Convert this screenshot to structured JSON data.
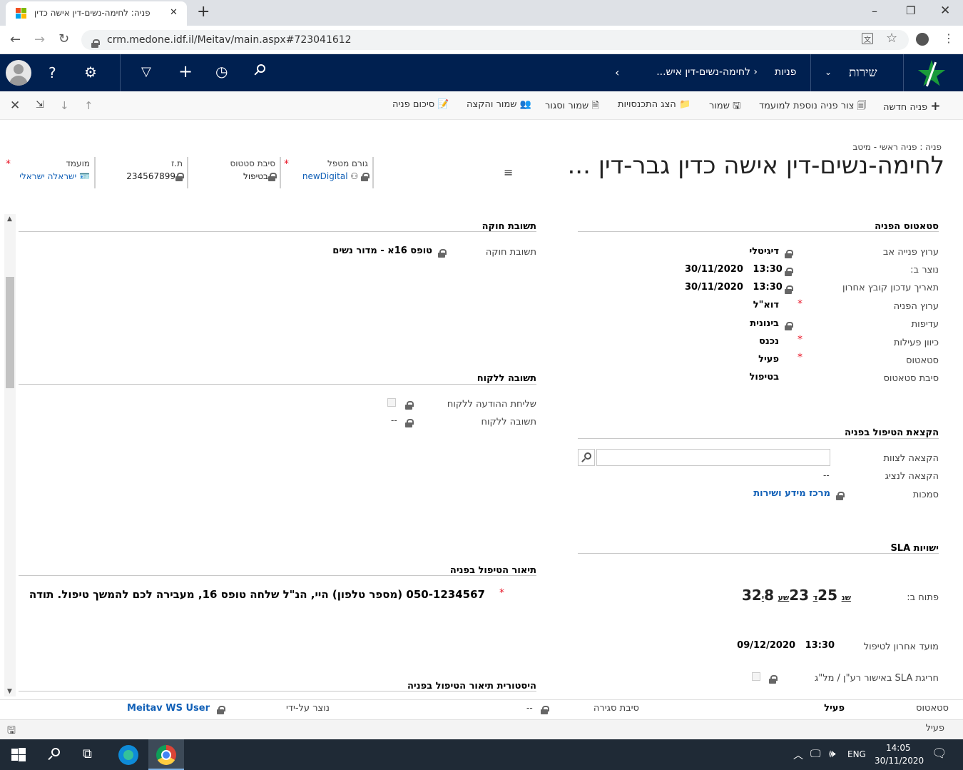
{
  "browser": {
    "tab_title": "פניה: לחימה-נשים-דין אישה כדין",
    "tab_close": "✕",
    "new_tab": "+",
    "url": "crm.medone.idf.il/Meitav/main.aspx#723041612",
    "win_min": "–",
    "win_max": "❐",
    "win_close": "✕"
  },
  "nav": {
    "app_name": "שירות",
    "area": "פניות",
    "record": "לחימה-נשים-דין איש..."
  },
  "toolbar": {
    "new_case": "פניה חדשה",
    "add_related": "צור פניה נוספת למועמד",
    "save": "שמור",
    "show_plans": "הצג התכנסויות",
    "save_close": "שמור וסגור",
    "save_assign": "שמור והקצה",
    "summary": "סיכום פניה"
  },
  "header": {
    "breadcrumb": "פניה : פניה ראשי - מיטב",
    "title": "לחימה-נשים-דין אישה כדין גבר-דין ...",
    "ellipsis": "...",
    "fields": [
      {
        "label": "גורם מטפל",
        "value": "newDigital"
      },
      {
        "label": "סיבת סטטוס",
        "value": "בטיפול"
      },
      {
        "label": "ת.ז",
        "value": "234567899"
      },
      {
        "label": "מועמד",
        "value": "ישראלה ישראלי"
      }
    ]
  },
  "status_section": {
    "title": "סטאטוס הפניה",
    "rows": [
      {
        "label": "ערוץ פנייה אב",
        "value": "דיגיטלי"
      },
      {
        "label": "נוצר ב:",
        "value": "30/11/2020   13:30"
      },
      {
        "label": "תאריך עדכון קובץ אחרון",
        "value": "30/11/2020   13:30"
      },
      {
        "label": "ערוץ הפניה",
        "value": "דוא\"ל"
      },
      {
        "label": "עדיפות",
        "value": "בינונית"
      },
      {
        "label": "כיוון פעילות",
        "value": "נכנס"
      },
      {
        "label": "סטאטוס",
        "value": "פעיל"
      },
      {
        "label": "סיבת סטאטוס",
        "value": "בטיפול"
      }
    ]
  },
  "assign_section": {
    "title": "הקצאת הטיפול בפניה",
    "team_label": "הקצאה לצוות",
    "rep_label": "הקצאה לנציג",
    "rep_value": "--",
    "auth_label": "סמכות",
    "auth_value": "מרכז מידע ושירות"
  },
  "sla_section": {
    "title": "SLA ישויות",
    "open_label": "פתוח ב:",
    "days": "8",
    "days_unit": "י",
    "hours": "23",
    "hours_unit": "שע",
    "minutes": "25",
    "minutes_unit": "ד",
    "seconds": "32",
    "seconds_unit": "שנ",
    "deadline_label": "מועד אחרון לטיפול",
    "deadline_value": "09/12/2020   13:30",
    "breach_label": "חריגת SLA באישור רע\"ן / מל\"ג"
  },
  "law_section": {
    "title": "תשובת חוקה",
    "label": "תשובת חוקה",
    "value": "טופס 16א - מדור נשים"
  },
  "client_section": {
    "title": "תשובה ללקוח",
    "send_label": "שליחת ההודעה ללקוח",
    "answer_label": "תשובה ללקוח",
    "answer_value": "--"
  },
  "desc_section": {
    "title": "תיאור הטיפול בפניה",
    "text": "050-1234567 (מספר טלפון) היי, הנ\"ל שלחה טופס 16, מעבירה לכם להמשך טיפול. תודה"
  },
  "history_section": {
    "title": "היסטורית תיאור הטיפול בפניה"
  },
  "footer": {
    "status_label": "סטאטוס",
    "status_value": "פעיל",
    "close_reason_label": "סיבת סגירה",
    "close_reason_value": "--",
    "created_by_label": "נוצר על-ידי",
    "created_by_value": "Meitav WS User",
    "bottom_status": "פעיל"
  },
  "taskbar": {
    "lang": "ENG",
    "time": "14:05",
    "date": "30/11/2020"
  },
  "colors": {
    "nav_bg": "#002050",
    "link": "#1160b7",
    "required": "#e81123"
  }
}
